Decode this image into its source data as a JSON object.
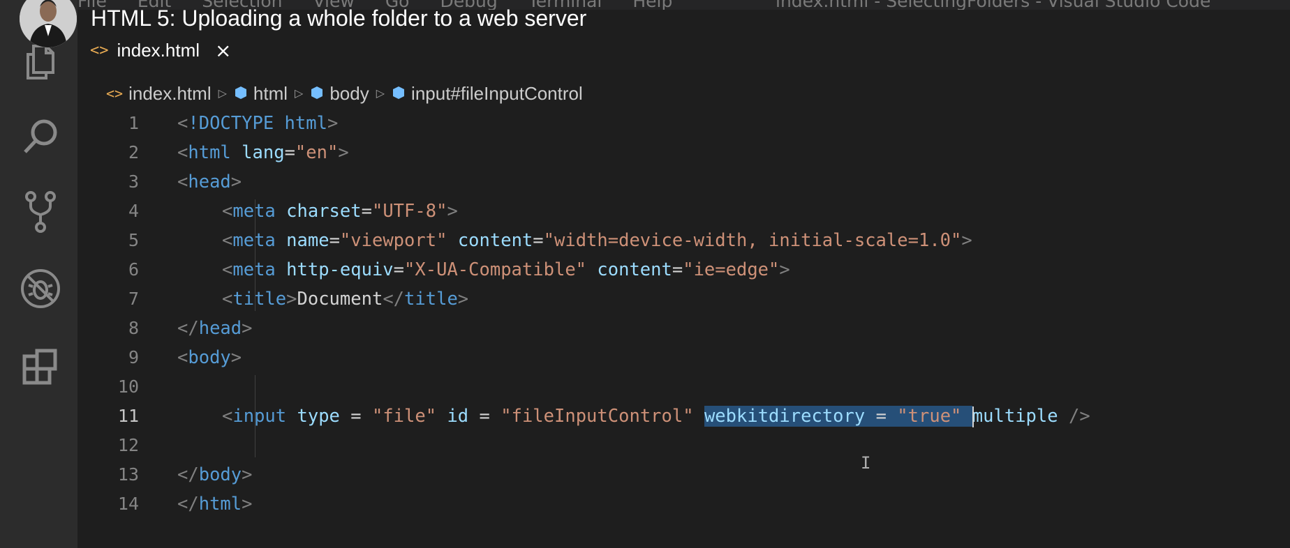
{
  "window": {
    "menu": [
      "File",
      "Edit",
      "Selection",
      "View",
      "Go",
      "Debug",
      "Terminal",
      "Help"
    ],
    "title": "index.html - SelectingFolders - Visual Studio Code"
  },
  "video": {
    "title": "HTML 5: Uploading a whole folder to a web server"
  },
  "activity_bar": {
    "items": [
      {
        "name": "explorer",
        "icon": "files-icon"
      },
      {
        "name": "search",
        "icon": "search-icon"
      },
      {
        "name": "source-control",
        "icon": "source-control-icon"
      },
      {
        "name": "debug",
        "icon": "debug-icon"
      },
      {
        "name": "extensions",
        "icon": "extensions-icon"
      }
    ]
  },
  "tab": {
    "icon": "<>",
    "label": "index.html",
    "close": "×"
  },
  "breadcrumb": {
    "file": "index.html",
    "items": [
      "html",
      "body",
      "input#fileInputControl"
    ]
  },
  "editor": {
    "active_line": 11,
    "selection": "webkitdirectory = \"true\" ",
    "lines": [
      {
        "n": "1",
        "indent": 0,
        "tokens": [
          [
            "p",
            "<"
          ],
          [
            "k",
            "!DOCTYPE"
          ],
          [
            "x",
            " "
          ],
          [
            "k",
            "html"
          ],
          [
            "p",
            ">"
          ]
        ]
      },
      {
        "n": "2",
        "indent": 0,
        "tokens": [
          [
            "p",
            "<"
          ],
          [
            "k",
            "html"
          ],
          [
            "x",
            " "
          ],
          [
            "a",
            "lang"
          ],
          [
            "x",
            "="
          ],
          [
            "s",
            "\"en\""
          ],
          [
            "p",
            ">"
          ]
        ]
      },
      {
        "n": "3",
        "indent": 0,
        "tokens": [
          [
            "p",
            "<"
          ],
          [
            "k",
            "head"
          ],
          [
            "p",
            ">"
          ]
        ]
      },
      {
        "n": "4",
        "indent": 1,
        "tokens": [
          [
            "p",
            "<"
          ],
          [
            "k",
            "meta"
          ],
          [
            "x",
            " "
          ],
          [
            "a",
            "charset"
          ],
          [
            "x",
            "="
          ],
          [
            "s",
            "\"UTF-8\""
          ],
          [
            "p",
            ">"
          ]
        ]
      },
      {
        "n": "5",
        "indent": 1,
        "tokens": [
          [
            "p",
            "<"
          ],
          [
            "k",
            "meta"
          ],
          [
            "x",
            " "
          ],
          [
            "a",
            "name"
          ],
          [
            "x",
            "="
          ],
          [
            "s",
            "\"viewport\""
          ],
          [
            "x",
            " "
          ],
          [
            "a",
            "content"
          ],
          [
            "x",
            "="
          ],
          [
            "s",
            "\"width=device-width, initial-scale=1.0\""
          ],
          [
            "p",
            ">"
          ]
        ]
      },
      {
        "n": "6",
        "indent": 1,
        "tokens": [
          [
            "p",
            "<"
          ],
          [
            "k",
            "meta"
          ],
          [
            "x",
            " "
          ],
          [
            "a",
            "http-equiv"
          ],
          [
            "x",
            "="
          ],
          [
            "s",
            "\"X-UA-Compatible\""
          ],
          [
            "x",
            " "
          ],
          [
            "a",
            "content"
          ],
          [
            "x",
            "="
          ],
          [
            "s",
            "\"ie=edge\""
          ],
          [
            "p",
            ">"
          ]
        ]
      },
      {
        "n": "7",
        "indent": 1,
        "tokens": [
          [
            "p",
            "<"
          ],
          [
            "k",
            "title"
          ],
          [
            "p",
            ">"
          ],
          [
            "x",
            "Document"
          ],
          [
            "p",
            "</"
          ],
          [
            "k",
            "title"
          ],
          [
            "p",
            ">"
          ]
        ]
      },
      {
        "n": "8",
        "indent": 0,
        "tokens": [
          [
            "p",
            "</"
          ],
          [
            "k",
            "head"
          ],
          [
            "p",
            ">"
          ]
        ]
      },
      {
        "n": "9",
        "indent": 0,
        "tokens": [
          [
            "p",
            "<"
          ],
          [
            "k",
            "body"
          ],
          [
            "p",
            ">"
          ]
        ]
      },
      {
        "n": "10",
        "indent": 1,
        "tokens": []
      },
      {
        "n": "11",
        "indent": 1,
        "tokens": [
          [
            "p",
            "<"
          ],
          [
            "k",
            "input"
          ],
          [
            "x",
            " "
          ],
          [
            "a",
            "type"
          ],
          [
            "x",
            " = "
          ],
          [
            "s",
            "\"file\""
          ],
          [
            "x",
            " "
          ],
          [
            "a",
            "id"
          ],
          [
            "x",
            " = "
          ],
          [
            "s",
            "\"fileInputControl\""
          ],
          [
            "x",
            " "
          ],
          [
            "sa",
            "webkitdirectory"
          ],
          [
            "sx",
            " = "
          ],
          [
            "ss",
            "\"true\""
          ],
          [
            "sx",
            " "
          ],
          [
            "a",
            "multiple"
          ],
          [
            "x",
            " "
          ],
          [
            "p",
            "/>"
          ]
        ]
      },
      {
        "n": "12",
        "indent": 1,
        "tokens": []
      },
      {
        "n": "13",
        "indent": 0,
        "tokens": [
          [
            "p",
            "</"
          ],
          [
            "k",
            "body"
          ],
          [
            "p",
            ">"
          ]
        ]
      },
      {
        "n": "14",
        "indent": 0,
        "tokens": [
          [
            "p",
            "</"
          ],
          [
            "k",
            "html"
          ],
          [
            "p",
            ">"
          ]
        ]
      }
    ]
  },
  "colors": {
    "background": "#1e1e1e",
    "activity_bar": "#2c2c2c",
    "tag": "#569cd6",
    "attribute": "#9cdcfe",
    "string": "#ce9178",
    "punctuation": "#808080",
    "selection": "#264f78",
    "tab_icon": "#e8ab53"
  }
}
